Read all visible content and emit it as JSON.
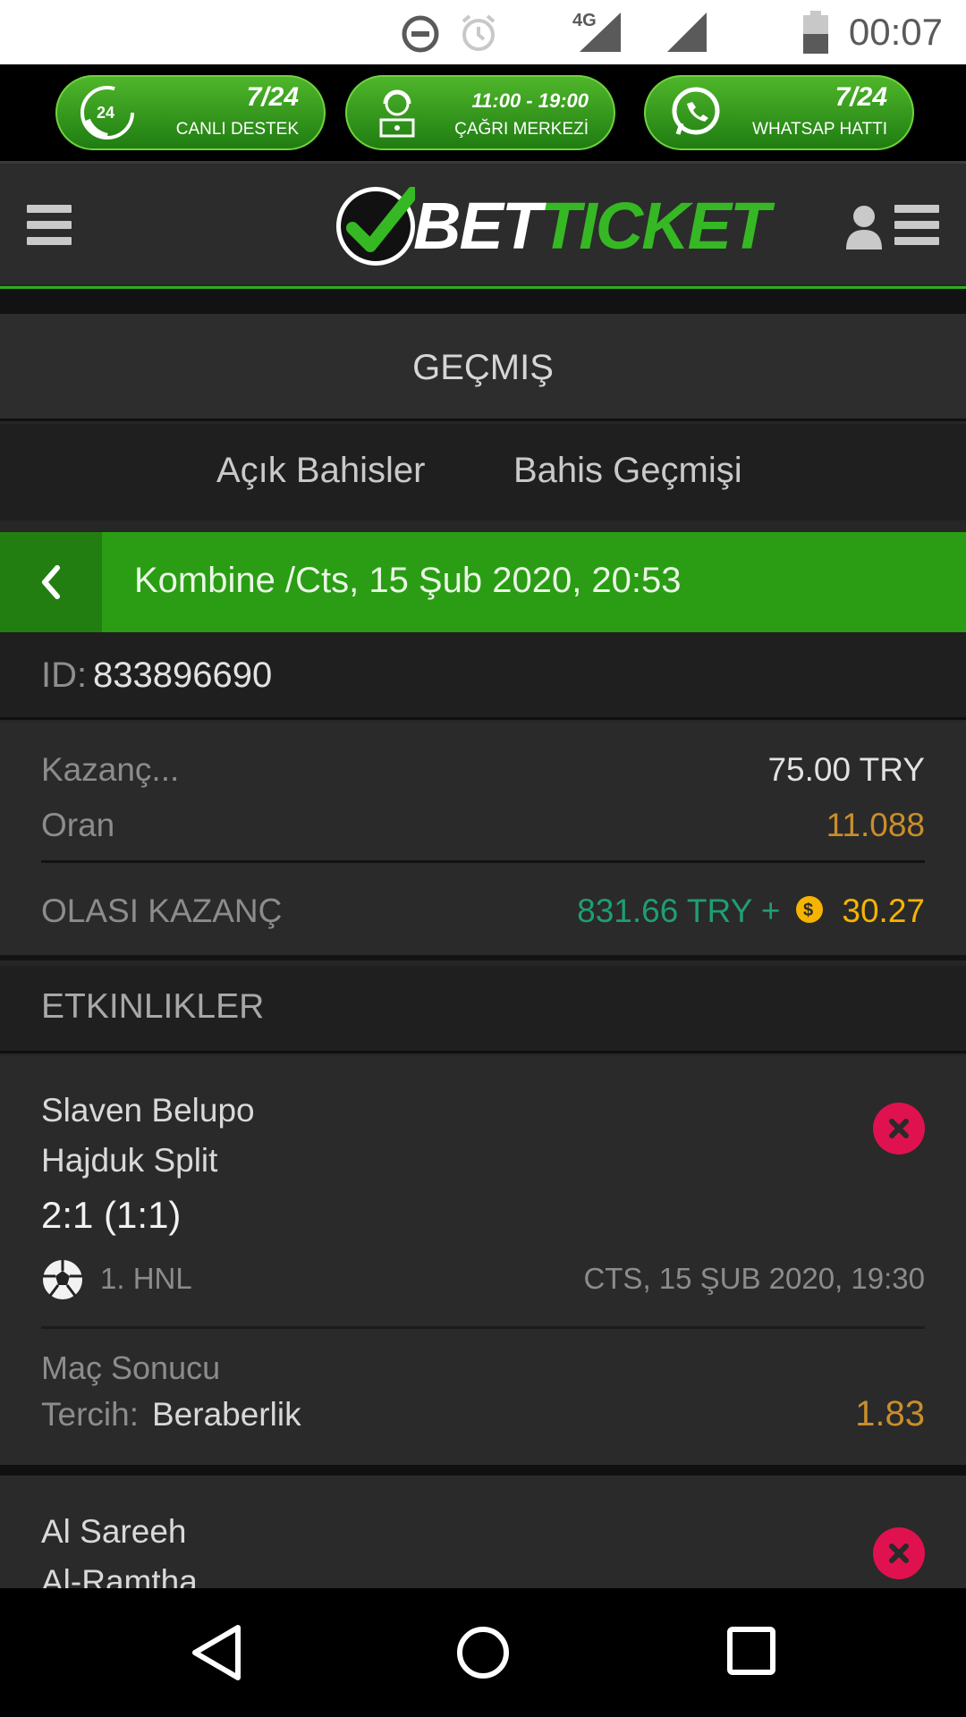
{
  "status_bar": {
    "time": "00:07",
    "network": "4G",
    "icons": [
      "do-not-disturb-icon",
      "alarm-icon",
      "signal-4g-icon",
      "signal-icon",
      "battery-icon"
    ]
  },
  "promo": [
    {
      "top": "7/24",
      "bottom": "CANLI DESTEK",
      "icon": "phone-24-icon"
    },
    {
      "top": "11:00 - 19:00",
      "bottom": "ÇAĞRI MERKEZİ",
      "icon": "call-center-agent-icon"
    },
    {
      "top": "7/24",
      "bottom": "WHATSAP HATTI",
      "icon": "whatsapp-icon"
    }
  ],
  "header": {
    "logo_white": "BET",
    "logo_green": "TICKET",
    "menu_icon": "hamburger-menu-icon",
    "user_icon": "user-icon"
  },
  "page": {
    "title": "GEÇMIŞ",
    "tabs": [
      "Açık Bahisler",
      "Bahis Geçmişi"
    ]
  },
  "bet": {
    "title": "Kombine /Cts, 15 Şub 2020, 20:53",
    "id_label": "ID:",
    "id_value": "833896690",
    "stake_label": "Kazanç...",
    "stake_value": "75.00 TRY",
    "odds_label": "Oran",
    "odds_value": "11.088",
    "potential_label": "OLASI KAZANÇ",
    "potential_value": "831.66 TRY +",
    "bonus_value": "30.27"
  },
  "events_title": "ETKINLIKLER",
  "events": [
    {
      "home": "Slaven Belupo",
      "away": "Hajduk Split",
      "score": "2:1 (1:1)",
      "league": "1. HNL",
      "date": "CTS, 15 ŞUB 2020, 19:30",
      "market": "Maç Sonucu",
      "choice_label": "Tercih:",
      "choice": "Beraberlik",
      "odd": "1.83"
    },
    {
      "home": "Al Sareeh",
      "away": "Al-Ramtha"
    }
  ],
  "colors": {
    "accent_green": "#2a9d14",
    "odds_gold": "#c98e2b",
    "potential_teal": "#1f9e72",
    "bonus_yellow": "#f5b400",
    "lost_red": "#e0114f"
  }
}
